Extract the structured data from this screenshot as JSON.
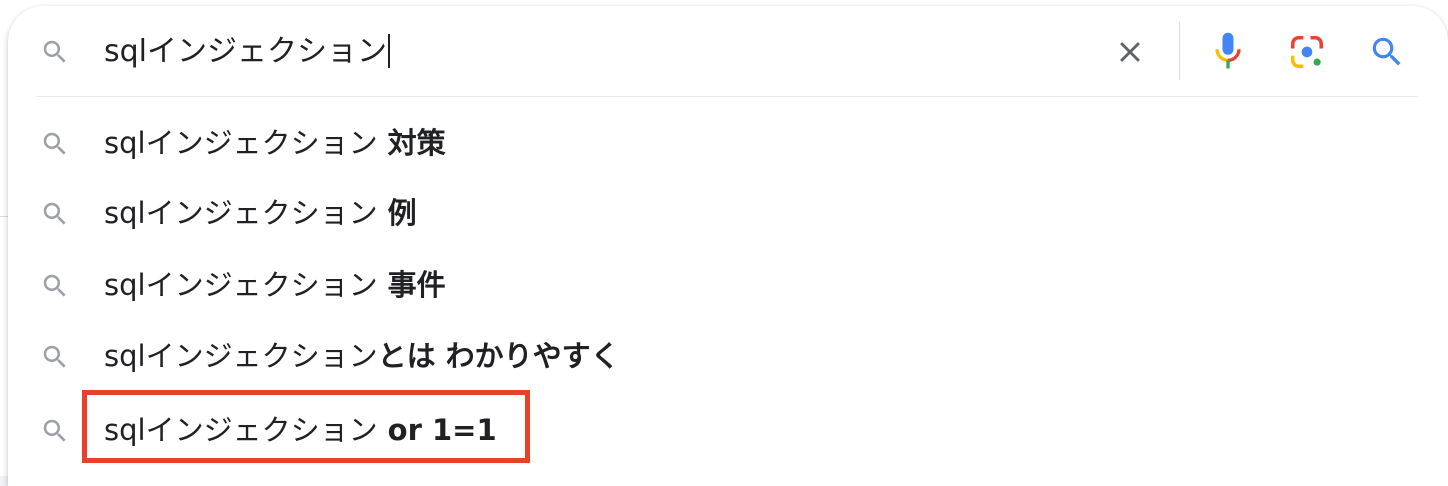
{
  "search": {
    "query": "sqlインジェクション",
    "clear_icon": "close-icon",
    "voice_icon": "microphone-icon",
    "lens_icon": "google-lens-icon",
    "submit_icon": "search-icon"
  },
  "suggestions": [
    {
      "prefix": "sqlインジェクション",
      "completion": " 対策"
    },
    {
      "prefix": "sqlインジェクション",
      "completion": " 例"
    },
    {
      "prefix": "sqlインジェクション",
      "completion": " 事件"
    },
    {
      "prefix": "sqlインジェクション",
      "completion": "とは わかりやすく"
    },
    {
      "prefix": "sqlインジェクション",
      "completion": " or 1=1",
      "highlighted": true
    }
  ],
  "colors": {
    "highlight_border": "#e8402a",
    "icon_gray": "#9aa0a6",
    "google_blue": "#4285f4",
    "google_red": "#ea4335",
    "google_yellow": "#fbbc04",
    "google_green": "#34a853"
  }
}
